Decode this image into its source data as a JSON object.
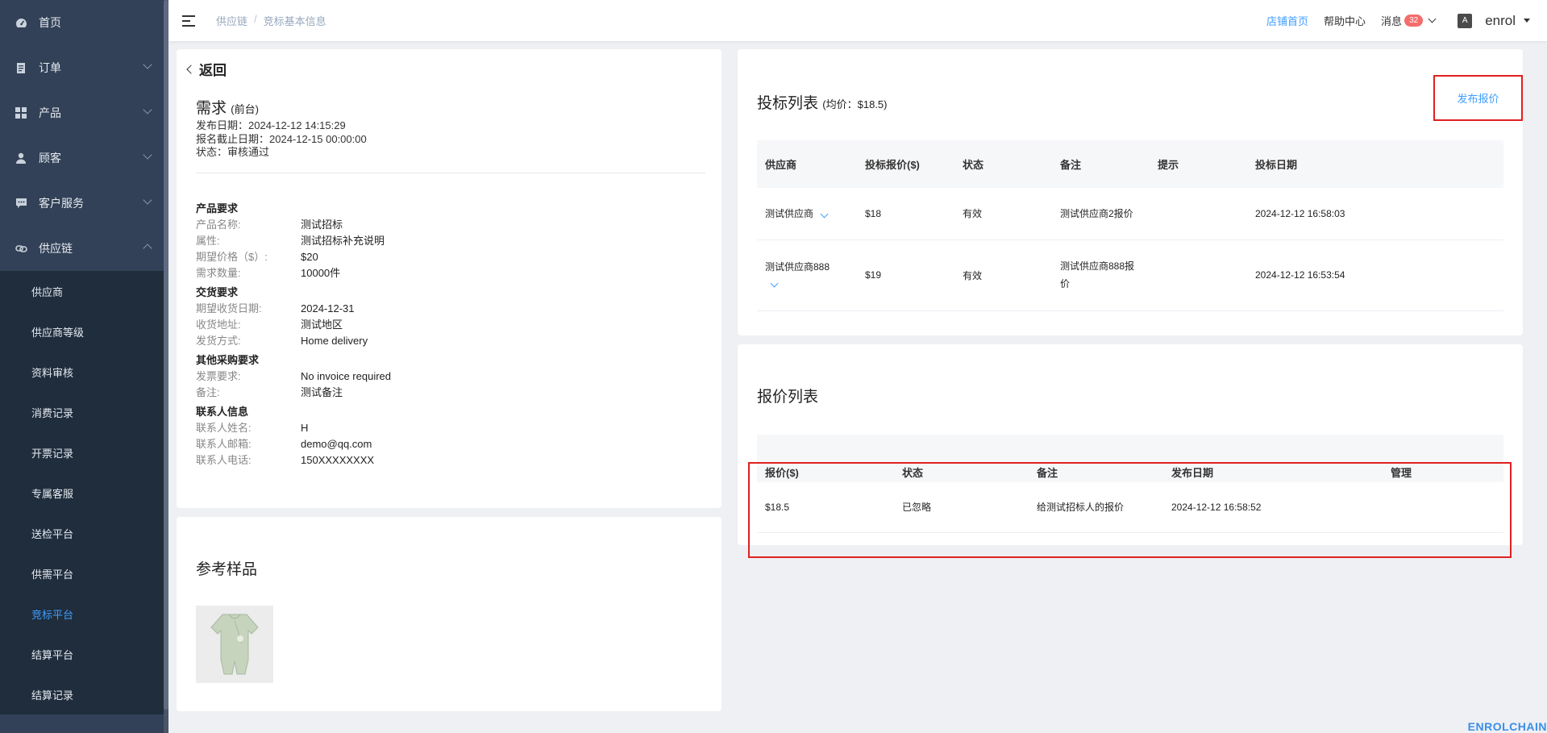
{
  "sidebar": {
    "items": [
      {
        "label": "首页",
        "icon": "dashboard-icon",
        "has_children": false
      },
      {
        "label": "订单",
        "icon": "order-icon",
        "has_children": true
      },
      {
        "label": "产品",
        "icon": "grid-icon",
        "has_children": true
      },
      {
        "label": "顾客",
        "icon": "user-icon",
        "has_children": true
      },
      {
        "label": "客户服务",
        "icon": "chat-icon",
        "has_children": true
      },
      {
        "label": "供应链",
        "icon": "link-icon",
        "has_children": true,
        "expanded": true
      }
    ],
    "sub_items": [
      "供应商",
      "供应商等级",
      "资料审核",
      "消费记录",
      "开票记录",
      "专属客服",
      "送检平台",
      "供需平台",
      "竞标平台",
      "结算平台",
      "结算记录"
    ],
    "active_sub": "竞标平台"
  },
  "header": {
    "breadcrumb": [
      "供应链",
      "竞标基本信息"
    ],
    "breadcrumb_sep": "/",
    "shop_home": "店铺首页",
    "help_center": "帮助中心",
    "messages": "消息",
    "message_count": "32",
    "lang_icon": "A",
    "user": "enrol"
  },
  "demand": {
    "back": "返回",
    "title": "需求",
    "title_note": "(前台)",
    "publish_date": "发布日期：2024-12-12 14:15:29",
    "deadline": "报名截止日期：2024-12-15 00:00:00",
    "status": "状态：审核通过",
    "sections": [
      {
        "title": "产品要求",
        "rows": [
          {
            "label": "产品名称:",
            "value": "测试招标"
          },
          {
            "label": "属性:",
            "value": "测试招标补充说明"
          },
          {
            "label": "期望价格（$）:",
            "value": "$20"
          },
          {
            "label": "需求数量:",
            "value": "10000件"
          }
        ]
      },
      {
        "title": "交货要求",
        "rows": [
          {
            "label": "期望收货日期:",
            "value": "2024-12-31"
          },
          {
            "label": "收货地址:",
            "value": "测试地区"
          },
          {
            "label": "发货方式:",
            "value": "Home delivery"
          }
        ]
      },
      {
        "title": "其他采购要求",
        "rows": [
          {
            "label": "发票要求:",
            "value": "No invoice required"
          },
          {
            "label": "备注:",
            "value": "测试备注"
          }
        ]
      },
      {
        "title": "联系人信息",
        "rows": [
          {
            "label": "联系人姓名:",
            "value": "H"
          },
          {
            "label": "联系人邮箱:",
            "value": "demo@qq.com"
          },
          {
            "label": "联系人电话:",
            "value": "150XXXXXXXX"
          }
        ]
      }
    ]
  },
  "sample": {
    "title": "参考样品"
  },
  "bids": {
    "title": "投标列表",
    "avg": "(均价：$18.5)",
    "publish_button": "发布报价",
    "columns": [
      "供应商",
      "投标报价($)",
      "状态",
      "备注",
      "提示",
      "投标日期"
    ],
    "rows": [
      {
        "supplier": "测试供应商",
        "price": "$18",
        "status": "有效",
        "remark": "测试供应商2报价",
        "hint": "",
        "date": "2024-12-12 16:58:03"
      },
      {
        "supplier": "测试供应商888",
        "price": "$19",
        "status": "有效",
        "remark": "测试供应商888报价",
        "hint": "",
        "date": "2024-12-12 16:53:54"
      }
    ]
  },
  "quotes": {
    "title": "报价列表",
    "columns": [
      "报价($)",
      "状态",
      "备注",
      "发布日期",
      "管理"
    ],
    "rows": [
      {
        "price": "$18.5",
        "status": "已忽略",
        "remark": "给测试招标人的报价",
        "date": "2024-12-12 16:58:52",
        "manage": ""
      }
    ]
  },
  "brand": "ENROLCHAIN",
  "colors": {
    "sidebar": "#324157",
    "submenu": "#1f2d3d",
    "accent": "#409eff",
    "highlight": "#e02020",
    "badge": "#f56c6c"
  }
}
